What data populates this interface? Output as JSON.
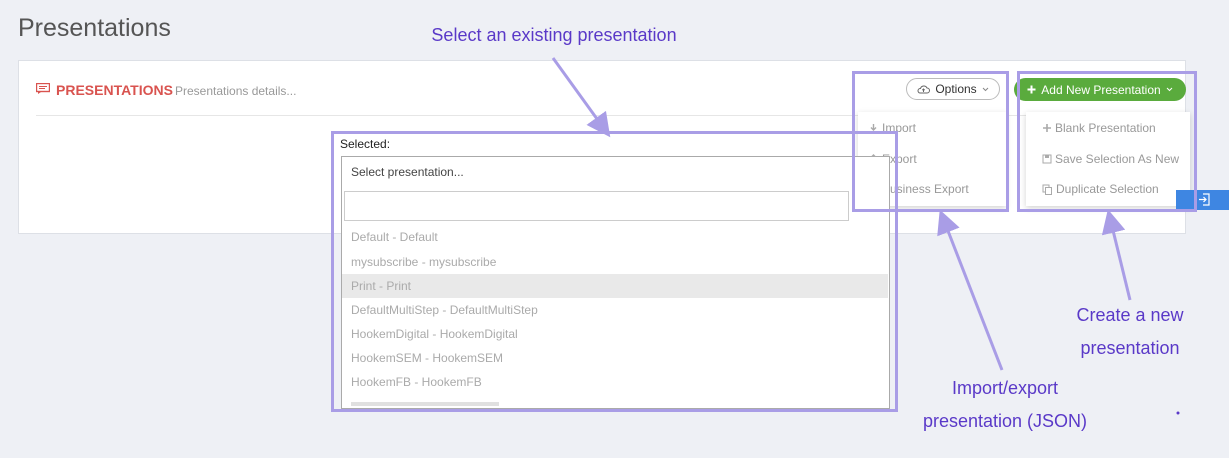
{
  "page": {
    "title": "Presentations"
  },
  "panel": {
    "title": "PRESENTATIONS",
    "subtitle": "Presentations details..."
  },
  "options": {
    "label": "Options",
    "items": [
      "Import",
      "Export",
      "Business Export"
    ]
  },
  "add_new": {
    "label": "Add New Presentation",
    "items": [
      "Blank Presentation",
      "Save Selection As New",
      "Duplicate Selection"
    ]
  },
  "selector": {
    "label": "Selected:",
    "placeholder": "Select presentation...",
    "options": [
      "Default - Default",
      "mysubscribe - mysubscribe",
      "Print - Print",
      "DefaultMultiStep - DefaultMultiStep",
      "HookemDigital - HookemDigital",
      "HookemSEM - HookemSEM",
      "HookemFB - HookemFB"
    ],
    "highlighted_index": 2
  },
  "annotations": {
    "select_existing": "Select an existing presentation",
    "import_export_line1": "Import/export",
    "import_export_line2": "presentation (JSON)",
    "create_new_line1": "Create a new",
    "create_new_line2": "presentation"
  },
  "colors": {
    "brand_red": "#d9534f",
    "add_green": "#5aab3d",
    "annotation_text": "#5a39c8",
    "annotation_box": "#a99de6",
    "blue_tab": "#3e86e2"
  }
}
